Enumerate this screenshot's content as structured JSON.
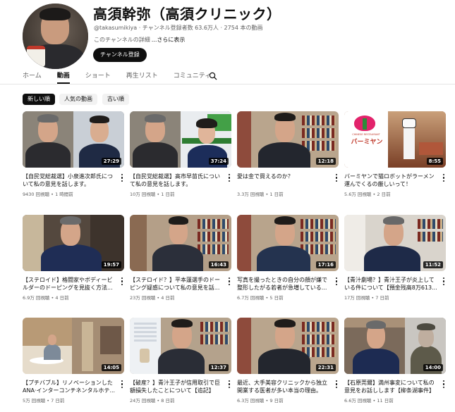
{
  "channel": {
    "name": "高須幹弥（高須クリニック）",
    "meta": "@takasumikiya · チャンネル登録者数 63.6万人 · 2754 本の動画",
    "desc": "このチャンネルの詳細",
    "more": "...さらに表示",
    "subscribe_label": "チャンネル登録"
  },
  "tabs": [
    "ホーム",
    "動画",
    "ショート",
    "再生リスト",
    "コミュニティ"
  ],
  "active_tab": "動画",
  "chips": [
    "新しい順",
    "人気の動画",
    "古い順"
  ],
  "active_chip": "新しい順",
  "videos": [
    {
      "title": "【自民党総裁選】小泉進次郎氏について私の意見を話します。",
      "meta": "9430 回視聴 • 1 時間前",
      "duration": "27:29"
    },
    {
      "title": "【自民党総裁選】高市早苗氏について私の意見を話します。",
      "meta": "10万 回視聴 • 1 日前",
      "duration": "37:24"
    },
    {
      "title": "愛は金で買えるのか？",
      "meta": "3.3万 回視聴 • 1 日前",
      "duration": "12:18"
    },
    {
      "title": "バーミヤンで猫ロボットがラーメン運んでくるの厳しいって！",
      "meta": "5.6万 回視聴 • 2 日前",
      "duration": "8:55"
    },
    {
      "title": "【ステロイド】格闘家やボディービルダーのドーピングを見抜く方法...",
      "meta": "6.9万 回視聴 • 4 日前",
      "duration": "19:57"
    },
    {
      "title": "【ステロイド？】平本蓮選手のドーピング疑惑について私の意見を話...",
      "meta": "23万 回視聴 • 4 日前",
      "duration": "16:43"
    },
    {
      "title": "写真を撮ったときの自分の顔が嫌で整形したがる若者が急増している...",
      "meta": "6.7万 回視聴 • 5 日前",
      "duration": "17:16"
    },
    {
      "title": "【青汁劇場？】青汁王子が炎上している件について【預金残高8万613...",
      "meta": "17万 回視聴 • 7 日前",
      "duration": "11:52"
    },
    {
      "title": "【プチバブル】リノベーションしたANA·インターコンチネンタルホテ...",
      "meta": "5万 回視聴 • 7 日前",
      "duration": "14:05"
    },
    {
      "title": "【破産？】青汁王子が信用取引で巨額損失したことについて【追記】",
      "meta": "24万 回視聴 • 8 日前",
      "duration": "12:37"
    },
    {
      "title": "最近、大手美容クリニックから独立開業する医者が多い本当の理由。",
      "meta": "6.3万 回視聴 • 9 日前",
      "duration": "22:31"
    },
    {
      "title": "【石原莞爾】満州事変について私の意見をお話しします【柳条湖事件】",
      "meta": "6.6万 回視聴 • 11 日前",
      "duration": "14:00"
    }
  ],
  "thumbnail_text": {
    "bamiyan_logo": "バーミヤン",
    "bamiyan_sub": "CHINESE RESTAURANT"
  },
  "colors": {
    "subscribe_bg": "#0f0f0f",
    "active_chip_bg": "#0f0f0f",
    "chip_bg": "#f2f2f2",
    "meta_text": "#606060"
  },
  "icons": {
    "tab_search": "search-icon",
    "card_menu": "more-vert-icon"
  }
}
